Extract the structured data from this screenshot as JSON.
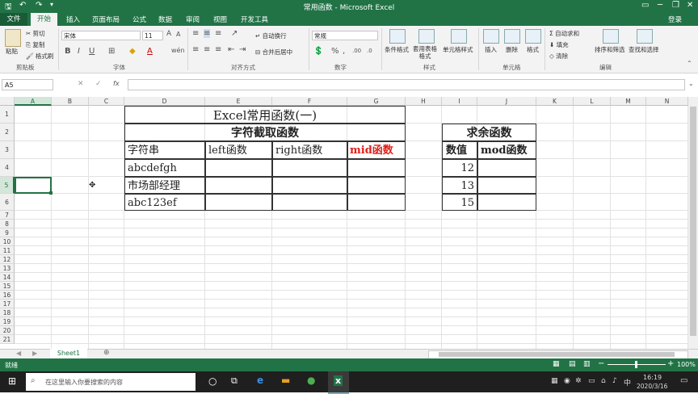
{
  "window": {
    "title": "常用函数 - Microsoft Excel",
    "login": "登录"
  },
  "menu": {
    "file": "文件",
    "tabs": [
      "开始",
      "插入",
      "页面布局",
      "公式",
      "数据",
      "审阅",
      "视图",
      "开发工具"
    ]
  },
  "ribbon": {
    "clipboard": {
      "paste": "粘贴",
      "cut": "剪切",
      "copy": "复制",
      "format_painter": "格式刷",
      "group": "剪贴板"
    },
    "font": {
      "name": "宋体",
      "size": "11",
      "group": "字体"
    },
    "alignment": {
      "wrap": "自动换行",
      "merge": "合并后居中",
      "group": "对齐方式"
    },
    "number": {
      "format": "常规",
      "group": "数字"
    },
    "styles": {
      "conditional": "条件格式",
      "table": "套用表格格式",
      "cell": "单元格样式",
      "group": "样式"
    },
    "cells": {
      "insert": "插入",
      "delete": "删除",
      "format": "格式",
      "group": "单元格"
    },
    "editing": {
      "autosum": "自动求和",
      "fill": "填充",
      "clear": "清除",
      "sort": "排序和筛选",
      "find": "查找和选择",
      "group": "编辑"
    }
  },
  "formula_bar": {
    "name_box": "A5",
    "fx": "fx",
    "value": ""
  },
  "grid": {
    "columns": [
      "A",
      "B",
      "C",
      "D",
      "E",
      "F",
      "G",
      "H",
      "I",
      "J",
      "K",
      "L",
      "M",
      "N"
    ],
    "rows": [
      "1",
      "2",
      "3",
      "4",
      "5",
      "6",
      "7",
      "8",
      "9",
      "10",
      "11",
      "12",
      "13",
      "14",
      "15",
      "16",
      "17",
      "18",
      "19",
      "20",
      "21"
    ]
  },
  "sheet": {
    "title": "Excel常用函数(一)",
    "left_table": {
      "header": "字符截取函数",
      "columns": [
        "字符串",
        "left函数",
        "right函数",
        "mid函数"
      ],
      "rows": [
        "abcdefgh",
        "市场部经理",
        "abc123ef"
      ]
    },
    "right_table": {
      "header": "求余函数",
      "columns": [
        "数值",
        "mod函数"
      ],
      "rows": [
        "12",
        "13",
        "15"
      ]
    },
    "accent_red": "#e0201a"
  },
  "sheet_tabs": {
    "active": "Sheet1"
  },
  "status": {
    "mode": "就绪",
    "zoom": "100%"
  },
  "taskbar": {
    "search_placeholder": "在这里输入你要搜索的内容",
    "time": "16:19",
    "date": "2020/3/16",
    "ime": "中"
  }
}
